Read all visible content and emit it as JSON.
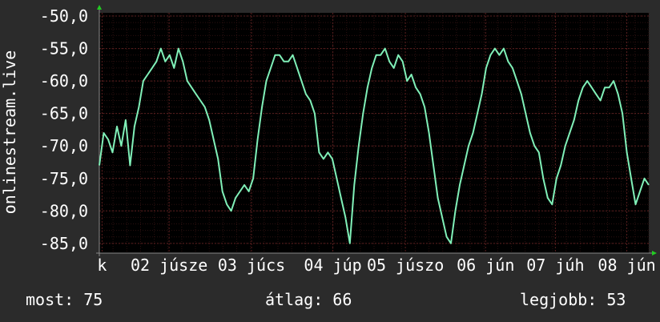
{
  "chart_data": {
    "type": "line",
    "ylabel": "onlinestream.live",
    "ylim": [
      -86.5,
      -49.5
    ],
    "yticks": [
      -50,
      -55,
      -60,
      -65,
      -70,
      -75,
      -80,
      -85
    ],
    "ytick_labels": [
      "-50,0",
      "-55,0",
      "-60,0",
      "-65,0",
      "-70,0",
      "-75,0",
      "-80,0",
      "-85,0"
    ],
    "xlim": [
      0,
      100
    ],
    "xtick_labels": [
      {
        "pos": 0.5,
        "label": "k"
      },
      {
        "pos": 12.7,
        "label": "02 júsze"
      },
      {
        "pos": 27.7,
        "label": "03 júcs"
      },
      {
        "pos": 42.5,
        "label": "04 júp"
      },
      {
        "pos": 55.7,
        "label": "05 júszo"
      },
      {
        "pos": 70.3,
        "label": "06 jún"
      },
      {
        "pos": 83.0,
        "label": "07 júh"
      },
      {
        "pos": 96.0,
        "label": "08 jún"
      }
    ],
    "grid": true,
    "line_color": "#80f0b8",
    "series": [
      {
        "values": [
          [
            0,
            -73
          ],
          [
            0.8,
            -68
          ],
          [
            1.6,
            -69
          ],
          [
            2.4,
            -71
          ],
          [
            3.2,
            -67
          ],
          [
            4.0,
            -70
          ],
          [
            4.8,
            -66
          ],
          [
            5.6,
            -73
          ],
          [
            6.4,
            -67
          ],
          [
            7.2,
            -64
          ],
          [
            8.0,
            -60
          ],
          [
            8.8,
            -59
          ],
          [
            9.6,
            -58
          ],
          [
            10.4,
            -57
          ],
          [
            11.2,
            -55
          ],
          [
            12.0,
            -57
          ],
          [
            12.8,
            -56
          ],
          [
            13.6,
            -58
          ],
          [
            14.4,
            -55
          ],
          [
            15.2,
            -57
          ],
          [
            16.0,
            -60
          ],
          [
            16.8,
            -61
          ],
          [
            17.6,
            -62
          ],
          [
            18.4,
            -63
          ],
          [
            19.2,
            -64
          ],
          [
            20.0,
            -66
          ],
          [
            20.8,
            -69
          ],
          [
            21.6,
            -72
          ],
          [
            22.4,
            -77
          ],
          [
            23.2,
            -79
          ],
          [
            24.0,
            -80
          ],
          [
            24.8,
            -78
          ],
          [
            25.6,
            -77
          ],
          [
            26.4,
            -76
          ],
          [
            27.2,
            -77
          ],
          [
            28.0,
            -75
          ],
          [
            28.8,
            -69
          ],
          [
            29.6,
            -64
          ],
          [
            30.4,
            -60
          ],
          [
            31.2,
            -58
          ],
          [
            32.0,
            -56
          ],
          [
            32.8,
            -56
          ],
          [
            33.6,
            -57
          ],
          [
            34.4,
            -57
          ],
          [
            35.2,
            -56
          ],
          [
            36.0,
            -58
          ],
          [
            36.8,
            -60
          ],
          [
            37.6,
            -62
          ],
          [
            38.4,
            -63
          ],
          [
            39.2,
            -65
          ],
          [
            40.0,
            -71
          ],
          [
            40.8,
            -72
          ],
          [
            41.6,
            -71
          ],
          [
            42.4,
            -72
          ],
          [
            43.2,
            -75
          ],
          [
            44.0,
            -78
          ],
          [
            44.8,
            -81
          ],
          [
            45.6,
            -85
          ],
          [
            46.4,
            -76
          ],
          [
            47.2,
            -70
          ],
          [
            48.0,
            -65
          ],
          [
            48.8,
            -61
          ],
          [
            49.6,
            -58
          ],
          [
            50.4,
            -56
          ],
          [
            51.2,
            -56
          ],
          [
            52.0,
            -55
          ],
          [
            52.8,
            -57
          ],
          [
            53.6,
            -58
          ],
          [
            54.4,
            -56
          ],
          [
            55.2,
            -57
          ],
          [
            56.0,
            -60
          ],
          [
            56.8,
            -59
          ],
          [
            57.6,
            -61
          ],
          [
            58.4,
            -62
          ],
          [
            59.2,
            -64
          ],
          [
            60.0,
            -68
          ],
          [
            60.8,
            -73
          ],
          [
            61.6,
            -78
          ],
          [
            62.4,
            -81
          ],
          [
            63.2,
            -84
          ],
          [
            64.0,
            -85
          ],
          [
            64.8,
            -80
          ],
          [
            65.6,
            -76
          ],
          [
            66.4,
            -73
          ],
          [
            67.2,
            -70
          ],
          [
            68.0,
            -68
          ],
          [
            68.8,
            -65
          ],
          [
            69.6,
            -62
          ],
          [
            70.4,
            -58
          ],
          [
            71.2,
            -56
          ],
          [
            72.0,
            -55
          ],
          [
            72.8,
            -56
          ],
          [
            73.6,
            -55
          ],
          [
            74.4,
            -57
          ],
          [
            75.2,
            -58
          ],
          [
            76.0,
            -60
          ],
          [
            76.8,
            -62
          ],
          [
            77.6,
            -65
          ],
          [
            78.4,
            -68
          ],
          [
            79.2,
            -70
          ],
          [
            80.0,
            -71
          ],
          [
            80.8,
            -75
          ],
          [
            81.6,
            -78
          ],
          [
            82.4,
            -79
          ],
          [
            83.2,
            -75
          ],
          [
            84.0,
            -73
          ],
          [
            84.8,
            -70
          ],
          [
            85.6,
            -68
          ],
          [
            86.4,
            -66
          ],
          [
            87.2,
            -63
          ],
          [
            88.0,
            -61
          ],
          [
            88.8,
            -60
          ],
          [
            89.6,
            -61
          ],
          [
            90.4,
            -62
          ],
          [
            91.2,
            -63
          ],
          [
            92.0,
            -61
          ],
          [
            92.8,
            -61
          ],
          [
            93.6,
            -60
          ],
          [
            94.4,
            -62
          ],
          [
            95.2,
            -65
          ],
          [
            96.0,
            -71
          ],
          [
            96.8,
            -75
          ],
          [
            97.6,
            -79
          ],
          [
            98.4,
            -77
          ],
          [
            99.2,
            -75
          ],
          [
            100,
            -76
          ]
        ]
      }
    ]
  },
  "stats": {
    "now": "most: 75",
    "avg": "átlag: 66",
    "max": "legjobb: 53"
  },
  "colors": {
    "background": "#2b2b2b",
    "plot_background": "#000000",
    "grid_major": "#5a1f1f",
    "grid_minor": "#2c1010",
    "axis_arrow": "#22cc22",
    "text": "#ffffff"
  }
}
